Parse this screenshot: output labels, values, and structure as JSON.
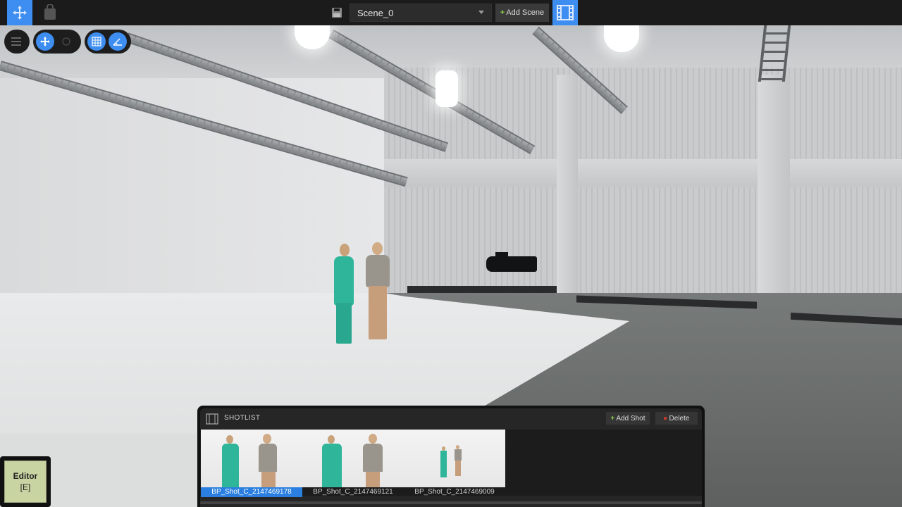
{
  "toolbar": {
    "scene_name": "Scene_0",
    "add_scene_label": "Add Scene",
    "accent_color": "#3d8ef0"
  },
  "viewport_tools": {
    "left_pill": [
      "layers-icon"
    ],
    "transform_pill": [
      "move-icon",
      "rotate-icon"
    ],
    "snap_pill": [
      "grid-icon",
      "angle-icon"
    ]
  },
  "shotlist": {
    "title": "SHOTLIST",
    "add_shot_label": "Add Shot",
    "delete_label": "Delete",
    "shots": [
      {
        "label": "BP_Shot_C_2147469178",
        "selected": true
      },
      {
        "label": "BP_Shot_C_2147469121",
        "selected": false
      },
      {
        "label": "BP_Shot_C_2147469009",
        "selected": false
      }
    ]
  },
  "editor_button": {
    "label": "Editor",
    "shortcut": "[E]"
  }
}
